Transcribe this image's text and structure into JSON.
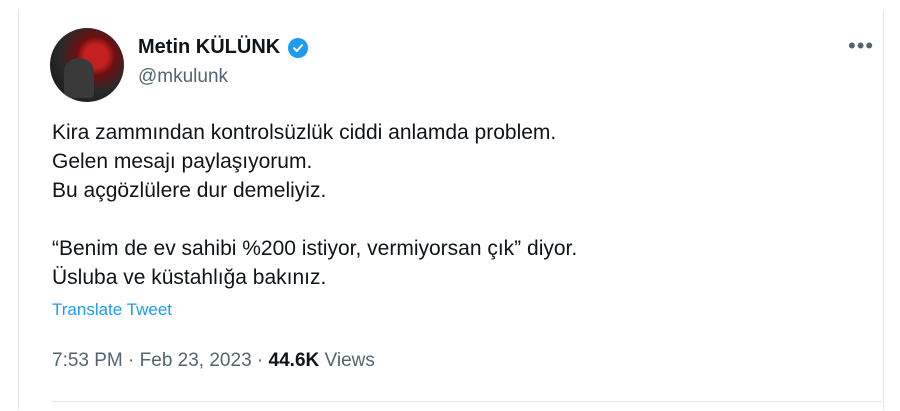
{
  "author": {
    "name": "Metin KÜLÜNK",
    "handle": "@mkulunk",
    "verified": true,
    "verified_color": "#1d9bf0"
  },
  "more_icon": "more-horizontal-icon",
  "tweet": {
    "lines": [
      "Kira zammından kontrolsüzlük ciddi anlamda problem.",
      "Gelen mesajı paylaşıyorum.",
      "Bu açgözlülere dur demeliyiz.",
      "",
      "“Benim de ev sahibi %200 istiyor, vermiyorsan çık” diyor.",
      "Üsluba ve küstahlığa bakınız."
    ],
    "translate_label": "Translate Tweet"
  },
  "meta": {
    "time": "7:53 PM",
    "separator": "·",
    "date": "Feb 23, 2023",
    "views_count": "44.6K",
    "views_label": "Views"
  },
  "colors": {
    "text": "#0f1419",
    "secondary": "#536471",
    "link": "#1d9bf0"
  }
}
